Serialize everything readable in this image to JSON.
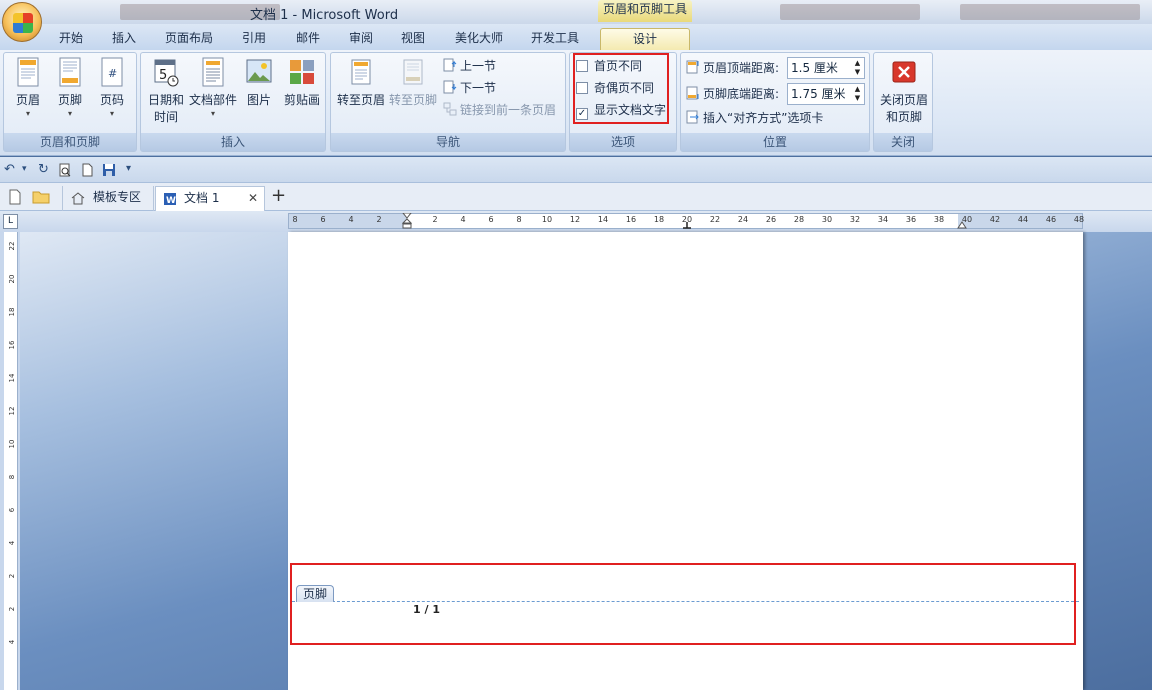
{
  "window": {
    "title": "文档 1 - Microsoft Word",
    "context_title": "页眉和页脚工具"
  },
  "tabs": [
    "开始",
    "插入",
    "页面布局",
    "引用",
    "邮件",
    "审阅",
    "视图",
    "美化大师",
    "开发工具",
    "设计"
  ],
  "active_tab": "设计",
  "groups": {
    "header_footer": {
      "label": "页眉和页脚",
      "header": "页眉",
      "footer": "页脚",
      "page_number": "页码"
    },
    "insert": {
      "label": "插入",
      "date_time_1": "日期和",
      "date_time_2": "时间",
      "doc_parts": "文档部件",
      "picture": "图片",
      "clipart": "剪贴画"
    },
    "navigation": {
      "label": "导航",
      "goto_header": "转至页眉",
      "goto_footer": "转至页脚",
      "prev_section": "上一节",
      "next_section": "下一节",
      "link_previous": "链接到前一条页眉"
    },
    "options": {
      "label": "选项",
      "different_first_page": "首页不同",
      "different_odd_even": "奇偶页不同",
      "show_doc_text": "显示文档文字",
      "show_doc_text_checked": true,
      "check_mark": "✓"
    },
    "position": {
      "label": "位置",
      "header_top_label": "页眉顶端距离:",
      "header_top_value": "1.5 厘米",
      "footer_bottom_label": "页脚底端距离:",
      "footer_bottom_value": "1.75 厘米",
      "insert_align_tab": "插入“对齐方式”选项卡"
    },
    "close": {
      "label": "关闭",
      "close_1": "关闭页眉",
      "close_2": "和页脚"
    }
  },
  "doc_tabs": {
    "template_zone": "模板专区",
    "document": "文档 1",
    "close": "✕",
    "add": "+"
  },
  "hruler_ticks": [
    "8",
    "6",
    "4",
    "2",
    "2",
    "4",
    "6",
    "8",
    "10",
    "12",
    "14",
    "16",
    "18",
    "20",
    "22",
    "24",
    "26",
    "28",
    "30",
    "32",
    "34",
    "36",
    "38",
    "40",
    "42",
    "44",
    "46",
    "48"
  ],
  "vruler_ticks": [
    "22",
    "20",
    "18",
    "16",
    "14",
    "12",
    "10",
    "8",
    "6",
    "4",
    "2",
    "2",
    "4"
  ],
  "document": {
    "footer_label": "页脚",
    "page_number_text": "1 / 1"
  },
  "colors": {
    "highlight_box": "#e02020",
    "accent_blue": "#4d6f9f"
  }
}
